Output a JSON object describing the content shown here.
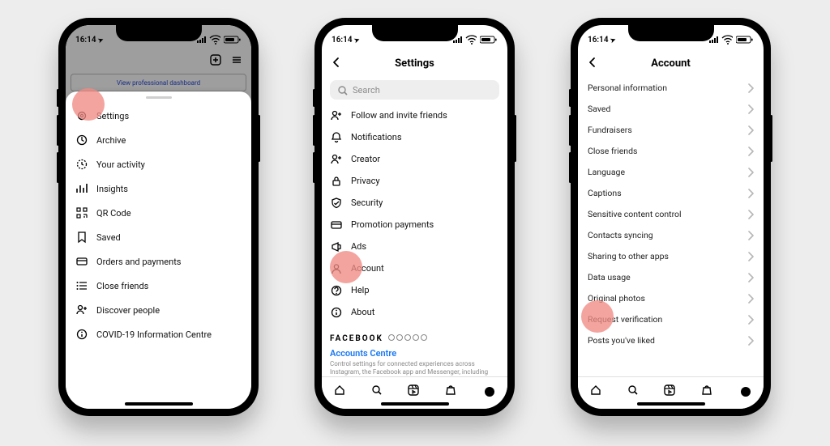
{
  "status": {
    "time": "16:14",
    "loc_glyph": "➤"
  },
  "phone1": {
    "banner": "View professional dashboard",
    "highlight_index": 0,
    "menu": [
      {
        "icon": "gear",
        "label": "Settings"
      },
      {
        "icon": "history",
        "label": "Archive"
      },
      {
        "icon": "clock",
        "label": "Your activity"
      },
      {
        "icon": "insights",
        "label": "Insights"
      },
      {
        "icon": "qr",
        "label": "QR Code"
      },
      {
        "icon": "bookmark",
        "label": "Saved"
      },
      {
        "icon": "card",
        "label": "Orders and payments"
      },
      {
        "icon": "list",
        "label": "Close friends"
      },
      {
        "icon": "adduser",
        "label": "Discover people"
      },
      {
        "icon": "info",
        "label": "COVID-19 Information Centre"
      }
    ]
  },
  "phone2": {
    "title": "Settings",
    "search_placeholder": "Search",
    "highlight_index": 7,
    "items": [
      {
        "icon": "adduser",
        "label": "Follow and invite friends"
      },
      {
        "icon": "bell",
        "label": "Notifications"
      },
      {
        "icon": "adduser",
        "label": "Creator"
      },
      {
        "icon": "lock",
        "label": "Privacy"
      },
      {
        "icon": "shield",
        "label": "Security"
      },
      {
        "icon": "card",
        "label": "Promotion payments"
      },
      {
        "icon": "megaphone",
        "label": "Ads"
      },
      {
        "icon": "user",
        "label": "Account"
      },
      {
        "icon": "help",
        "label": "Help"
      },
      {
        "icon": "info",
        "label": "About"
      }
    ],
    "fb_label": "FACEBOOK",
    "accounts_centre": "Accounts Centre",
    "accounts_note": "Control settings for connected experiences across Instagram, the Facebook app and Messenger, including story and post"
  },
  "phone3": {
    "title": "Account",
    "highlight_index": 11,
    "items": [
      "Personal information",
      "Saved",
      "Fundraisers",
      "Close friends",
      "Language",
      "Captions",
      "Sensitive content control",
      "Contacts syncing",
      "Sharing to other apps",
      "Data usage",
      "Original photos",
      "Request verification",
      "Posts you've liked"
    ]
  }
}
